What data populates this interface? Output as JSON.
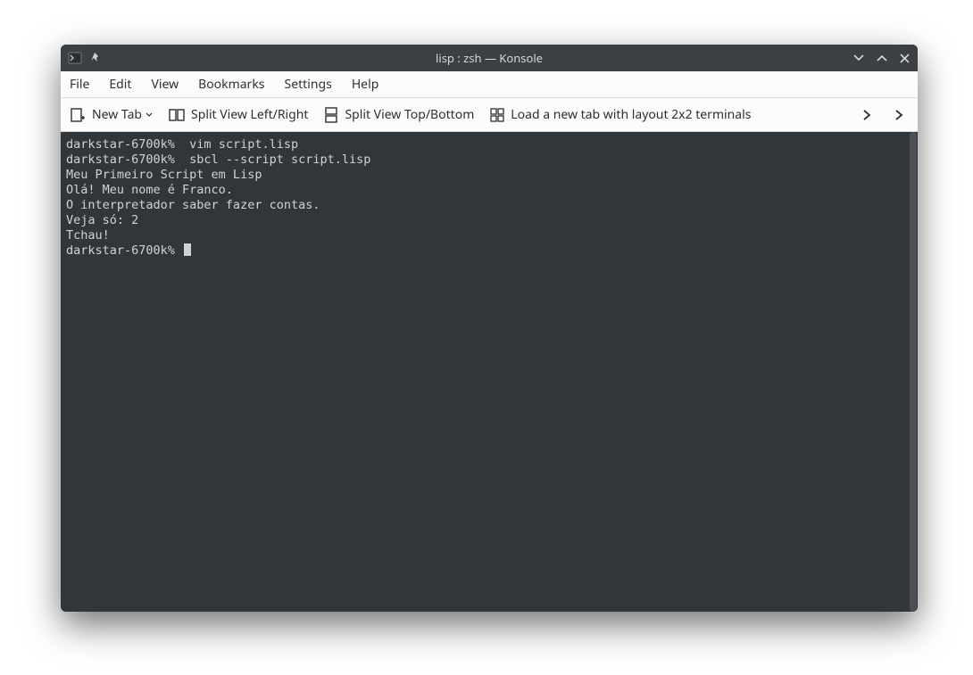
{
  "titlebar": {
    "title": "lisp : zsh — Konsole"
  },
  "menubar": {
    "items": [
      "File",
      "Edit",
      "View",
      "Bookmarks",
      "Settings",
      "Help"
    ]
  },
  "toolbar": {
    "new_tab": "New Tab",
    "split_lr": "Split View Left/Right",
    "split_tb": "Split View Top/Bottom",
    "load_layout": "Load a new tab with layout 2x2 terminals"
  },
  "terminal": {
    "lines": [
      {
        "prompt": "darkstar-6700k%",
        "cmd": "  vim script.lisp"
      },
      {
        "prompt": "darkstar-6700k%",
        "cmd": "  sbcl --script script.lisp"
      },
      {
        "text": "Meu Primeiro Script em Lisp"
      },
      {
        "text": "Olá! Meu nome é Franco."
      },
      {
        "text": "O interpretador saber fazer contas."
      },
      {
        "text": "Veja só: 2"
      },
      {
        "text": "Tchau!"
      },
      {
        "prompt": "darkstar-6700k%",
        "cursor": true
      }
    ]
  }
}
